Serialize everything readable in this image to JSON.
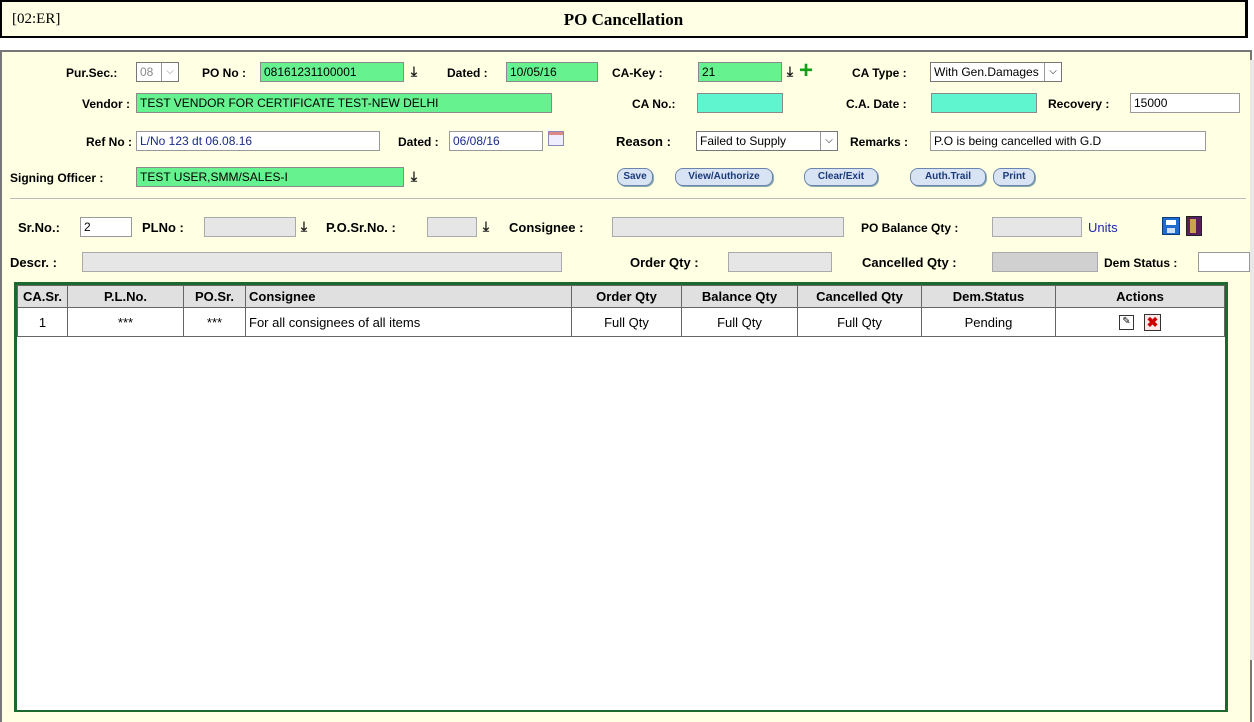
{
  "window": {
    "code": "[02:ER]",
    "title": "PO Cancellation"
  },
  "header": {
    "pursec_label": "Pur.Sec.:",
    "pursec_value": "08",
    "pono_label": "PO No :",
    "pono_value": "08161231100001",
    "dated_label": "Dated :",
    "dated_value": "10/05/16",
    "cakey_label": "CA-Key :",
    "cakey_value": "21",
    "catype_label": "CA Type :",
    "catype_value": "With Gen.Damages",
    "vendor_label": "Vendor :",
    "vendor_value": "TEST VENDOR FOR CERTIFICATE TEST-NEW DELHI",
    "cano_label": "CA No.:",
    "cano_value": "",
    "cadate_label": "C.A. Date :",
    "cadate_value": "",
    "recovery_label": "Recovery :",
    "recovery_value": "15000",
    "refno_label": "Ref No :",
    "refno_value": "L/No 123 dt 06.08.16",
    "refdated_label": "Dated :",
    "refdated_value": "06/08/16",
    "reason_label": "Reason :",
    "reason_value": "Failed to Supply",
    "remarks_label": "Remarks :",
    "remarks_value": "P.O is being cancelled with G.D",
    "officer_label": "Signing Officer :",
    "officer_value": "TEST USER,SMM/SALES-I"
  },
  "buttons": {
    "save": "Save",
    "view": "View/Authorize",
    "clear": "Clear/Exit",
    "auth": "Auth.Trail",
    "print": "Print"
  },
  "detail": {
    "srno_label": "Sr.No.:",
    "srno_value": "2",
    "plno_label": "PLNo :",
    "plno_value": "",
    "posrno_label": "P.O.Sr.No. :",
    "posrno_value": "",
    "consignee_label": "Consignee :",
    "consignee_value": "",
    "pobal_label": "PO Balance Qty :",
    "pobal_value": "",
    "units_label": "Units",
    "descr_label": "Descr. :",
    "descr_value": "",
    "orderqty_label": "Order Qty :",
    "orderqty_value": "",
    "cancqty_label": "Cancelled Qty :",
    "cancqty_value": "",
    "demstatus_label": "Dem Status :",
    "demstatus_value": ""
  },
  "table": {
    "headers": [
      "CA.Sr.",
      "P.L.No.",
      "PO.Sr.",
      "Consignee",
      "Order Qty",
      "Balance Qty",
      "Cancelled Qty",
      "Dem.Status",
      "Actions"
    ],
    "rows": [
      [
        "1",
        "***",
        "***",
        "For all consignees of all items",
        "Full Qty",
        "Full Qty",
        "Full Qty",
        "Pending"
      ]
    ]
  },
  "icons": {
    "lookup": "down-arrow-icon",
    "add": "plus-icon",
    "calendar": "calendar-icon",
    "save": "floppy-icon",
    "exit": "exit-door-icon",
    "edit": "edit-icon",
    "delete": "delete-icon"
  }
}
